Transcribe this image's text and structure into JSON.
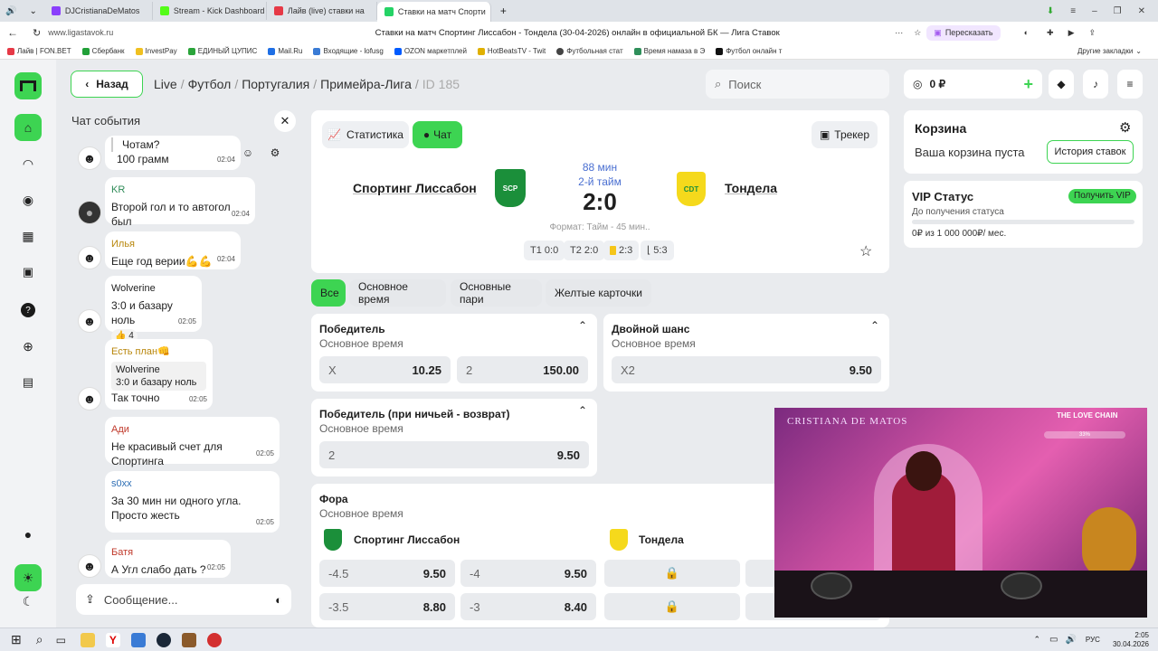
{
  "browser": {
    "tabs": [
      {
        "label": "DJCristianaDeMatos",
        "icon_color": "#8a3ffc"
      },
      {
        "label": "Stream - Kick Dashboard",
        "icon_color": "#53fc18"
      },
      {
        "label": "Лайв (live) ставки на",
        "icon_color": "#e63946"
      },
      {
        "label": "Ставки на матч Спорти",
        "icon_color": "#25d366"
      }
    ],
    "url": "www.ligastavok.ru",
    "page_title": "Ставки на матч Спортинг Лиссабон - Тондела (30-04-2026) онлайн в официальной БК — Лига Ставок",
    "retell_label": "Пересказать",
    "bookmarks": [
      "Лайв | FON.BET",
      "Сбербанк",
      "InvestPay",
      "ЕДИНЫЙ ЦУПИС",
      "Mail.Ru",
      "Входящие - lofusg",
      "OZON маркетплей",
      "HotBeatsTV - Twit",
      "Футбольная стат",
      "Время намаза в Э",
      "Футбол онлайн т"
    ],
    "other_bookmarks": "Другие закладки"
  },
  "header": {
    "back_label": "Назад",
    "breadcrumb": [
      "Live",
      "Футбол",
      "Португалия",
      "Примейра-Лига"
    ],
    "breadcrumb_id": "ID 185",
    "search_placeholder": "Поиск",
    "balance": "0 ₽"
  },
  "chat": {
    "title": "Чат события",
    "messages": [
      {
        "user": "",
        "quote": "",
        "text": "Чотам?",
        "text2": "100 грамм",
        "time": "02:04"
      },
      {
        "user": "KR",
        "user_color": "#2e8b57",
        "text": "Второй гол и то автогол был",
        "time": "02:04"
      },
      {
        "user": "Илья",
        "user_color": "#b8860b",
        "text": "Еще год верии💪💪",
        "time": "02:04"
      },
      {
        "user": "Wolverine",
        "user_color": "#333333",
        "text": "3:0 и базару ноль",
        "reaction": "👍 4",
        "time": "02:05"
      },
      {
        "user": "Есть план👊",
        "user_color": "#b8860b",
        "quote_user": "Wolverine",
        "quote_text": "3:0 и базару ноль",
        "text": "Так точно",
        "time": "02:05"
      },
      {
        "user": "Ади",
        "user_color": "#c0392b",
        "text": "Не красивый счет для Спортинга",
        "time": "02:05"
      },
      {
        "user": "s0xx",
        "user_color": "#2e6fb5",
        "text": "За 30 мин ни одного угла.",
        "text2": "Просто жесть",
        "time": "02:05"
      },
      {
        "user": "Батя",
        "user_color": "#c0392b",
        "text": "А Угл слабо дать ?",
        "time": "02:05"
      }
    ],
    "input_placeholder": "Сообщение..."
  },
  "match": {
    "tab_stats": "Статистика",
    "tab_chat": "Чат",
    "tracker": "Трекер",
    "team1": "Спортинг Лиссабон",
    "team2": "Тондела",
    "minute": "88 мин",
    "half": "2-й тайм",
    "score": "2:0",
    "format": "Формат: Тайм - 45 мин..",
    "periods": [
      "T1 0:0",
      "T2 2:0",
      "2:3",
      "5:3"
    ]
  },
  "filters": [
    "Все",
    "Основное время",
    "Основные пари",
    "Желтые карточки"
  ],
  "markets": {
    "winner": {
      "title": "Победитель",
      "sub": "Основное время",
      "odds": [
        {
          "k": "X",
          "v": "10.25"
        },
        {
          "k": "2",
          "v": "150.00"
        }
      ]
    },
    "double": {
      "title": "Двойной шанс",
      "sub": "Основное время",
      "odds": [
        {
          "k": "X2",
          "v": "9.50"
        }
      ]
    },
    "dnb": {
      "title": "Победитель (при ничьей - возврат)",
      "sub": "Основное время",
      "odds": [
        {
          "k": "2",
          "v": "9.50"
        }
      ]
    },
    "handicap": {
      "title": "Фора",
      "sub": "Основное время",
      "team1": "Спортинг Лиссабон",
      "team2": "Тондела",
      "rows": [
        [
          {
            "k": "-4.5",
            "v": "9.50"
          },
          {
            "k": "-4",
            "v": "9.50"
          }
        ],
        [
          {
            "k": "-3.5",
            "v": "8.80"
          },
          {
            "k": "-3",
            "v": "8.40"
          }
        ]
      ]
    }
  },
  "basket": {
    "title": "Корзина",
    "empty": "Ваша корзина пуста",
    "history": "История ставок"
  },
  "vip": {
    "title": "VIP Статус",
    "badge": "Получить VIP",
    "sub": "До получения статуса",
    "progress_text": "0₽ из 1 000 000₽/ мес.",
    "progress": 0
  },
  "stream": {
    "title": "CRISTIANA DE MATOS",
    "chain_label": "THE LOVE CHAIN",
    "level_pct": "33%"
  },
  "taskbar": {
    "lang": "РУС",
    "time": "2:05",
    "date": "30.04.2026"
  },
  "colors": {
    "accent": "#3dd452",
    "link_blue": "#4a6fd1"
  }
}
